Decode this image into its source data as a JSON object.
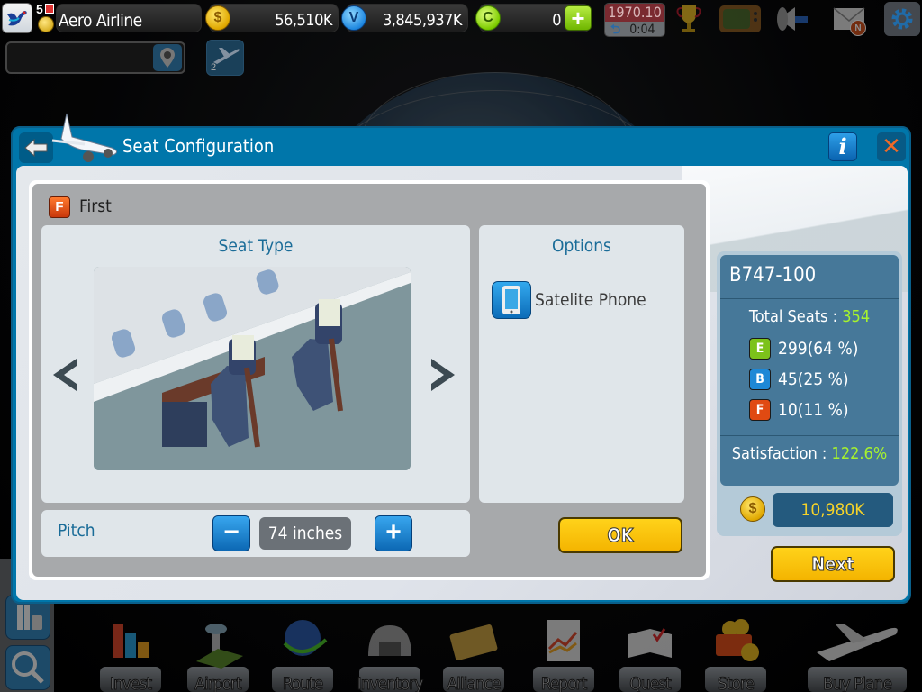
{
  "topbar": {
    "level": "5",
    "airline_name": "Aero Airline",
    "gold_coins": "56,510K",
    "blue_coins": "3,845,937K",
    "green_coins": "0",
    "date": "1970.10",
    "timer": "0:04",
    "mail_badge": "N",
    "icons": [
      "swan-logo-icon",
      "medal-icon",
      "gold-coin-icon",
      "v-coin-icon",
      "c-coin-icon",
      "plus-icon",
      "rewind-icon",
      "trophy-icon",
      "tv-icon",
      "megaphone-icon",
      "mail-icon",
      "gear-icon"
    ]
  },
  "search": {
    "placeholder": "",
    "value": "",
    "plane_count": "2"
  },
  "dialog": {
    "title": "Seat Configuration",
    "info_label": "i",
    "close_label": "✕",
    "class_badge": "F",
    "class_name": "First",
    "seat_type_title": "Seat Type",
    "options_title": "Options",
    "options": [
      {
        "icon": "phone-icon",
        "label": "Satelite Phone"
      }
    ],
    "pitch_label": "Pitch",
    "pitch_value": "74 inches",
    "minus_label": "−",
    "plus_label": "+",
    "ok_label": "OK",
    "next_label": "Next"
  },
  "stats": {
    "plane_model": "B747-100",
    "total_seats_label": "Total Seats : ",
    "total_seats": "354",
    "classes": [
      {
        "badge": "E",
        "text": "299(64 %)",
        "color": "#7cc21a"
      },
      {
        "badge": "B",
        "text": "45(25 %)",
        "color": "#1e88d6"
      },
      {
        "badge": "F",
        "text": "10(11 %)",
        "color": "#e04a12"
      }
    ],
    "satisfaction_label": "Satisfaction : ",
    "satisfaction": "122.6%",
    "cost": "10,980K"
  },
  "bottom_nav": [
    {
      "label": "Invest",
      "icon": "bar-chart-icon"
    },
    {
      "label": "Airport",
      "icon": "control-tower-icon"
    },
    {
      "label": "Route",
      "icon": "globe-route-icon"
    },
    {
      "label": "Inventory",
      "icon": "hangar-icon"
    },
    {
      "label": "Alliance",
      "icon": "card-icon"
    },
    {
      "label": "Report",
      "icon": "report-icon"
    },
    {
      "label": "Quest",
      "icon": "quest-book-icon"
    },
    {
      "label": "Store",
      "icon": "coin-basket-icon"
    },
    {
      "label": "Buy Plane",
      "icon": "airplane-icon"
    }
  ],
  "side_buttons": [
    "passengers-luggage-icon",
    "people-search-icon"
  ],
  "colors": {
    "dialog_blue": "#0076aa",
    "accent_yellow": "#ffc800",
    "value_green": "#a6f22e",
    "title_blue": "#1a6c98"
  }
}
